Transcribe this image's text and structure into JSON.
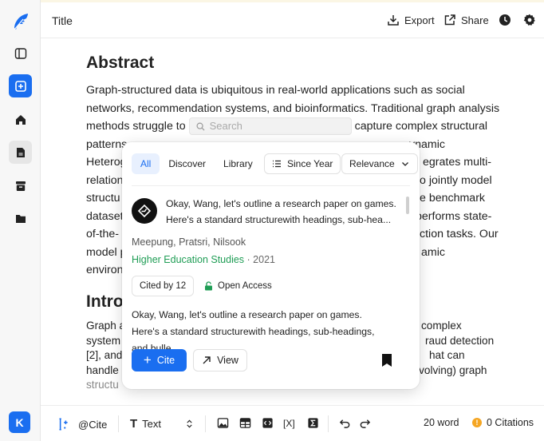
{
  "header": {
    "title": "Title",
    "export_label": "Export",
    "share_label": "Share"
  },
  "sidebar": {
    "avatar_initial": "K"
  },
  "document": {
    "abstract_heading": "Abstract",
    "line1": "Graph-structured data is ubiquitous in real-world applications such as social",
    "line2": "networks, recommendation systems, and bioinformatics. Traditional graph analysis",
    "line3_before": "methods struggle to",
    "line3_after": "capture complex structural",
    "line4_left": "patterns",
    "line4_right": "ynamic",
    "line5_left": "Heterog",
    "line5_right": "egrates multi-",
    "line6_left": "relation",
    "line6_right": "o jointly model",
    "line7_left": "structu",
    "line7_right": "e benchmark",
    "line8_left": "dataset",
    "line8_right": "performs state-",
    "line9_left": "of-the-",
    "line9_right": "ction tasks. Our",
    "line10_left": "model p",
    "line10_right": "amic",
    "line11_left": "environ",
    "intro_heading": "Intro",
    "intro1_left": "Graph a",
    "intro1_right": "complex",
    "intro2_left": "system",
    "intro2_right": "raud detection",
    "intro3_left": "[2], and",
    "intro3_right": "hat can",
    "intro4_left": "handle",
    "intro4_right": "-evolving) graph",
    "intro5_left": "structu"
  },
  "inline_search": {
    "placeholder": "Search"
  },
  "popup": {
    "tabs": [
      {
        "label": "All",
        "active": true
      },
      {
        "label": "Discover",
        "active": false
      },
      {
        "label": "Library",
        "active": false
      }
    ],
    "since_year_label": "Since Year",
    "sort_label": "Relevance",
    "result": {
      "title": "Okay, Wang, let's outline a research paper on games. Here's a standard structurewith headings, sub-hea...",
      "authors": "Meepung, Pratsri, Nilsook",
      "journal": "Higher Education Studies",
      "year": " · 2021",
      "cited_by": "Cited by 12",
      "access": "Open Access",
      "snippet": "Okay, Wang, let's outline a research paper on games. Here's a standard structurewith headings, sub-headings, and bulle",
      "cite_label": "Cite",
      "view_label": "View"
    }
  },
  "toolbar": {
    "cite_label": "@Cite",
    "text_style_label": "Text",
    "word_count": "20 word",
    "citations": "0 Citations"
  },
  "colors": {
    "accent": "#1a6ef0",
    "journal_green": "#1f9d55",
    "warning": "#f5a623"
  }
}
